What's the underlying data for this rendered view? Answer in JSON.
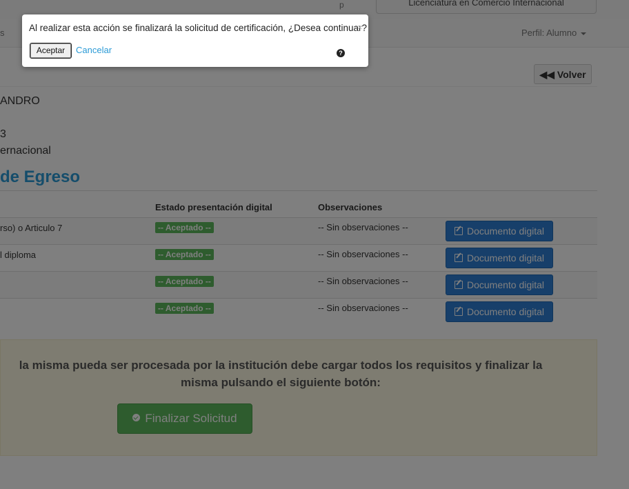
{
  "topbar": {
    "stub_text": "p",
    "career_select_value": "Licenciatura en Comercio Internacional"
  },
  "navbar": {
    "left_stub": "s",
    "perfil_label": "Perfil: Alumno"
  },
  "back_button_label": "Volver",
  "student_info": {
    "name_fragment": "ANDRO",
    "line2_fragment": "3",
    "line3_fragment": "ernacional"
  },
  "section_title": "de Egreso",
  "table": {
    "headers": {
      "estado": "Estado presentación digital",
      "observaciones": "Observaciones"
    },
    "rows": [
      {
        "requisito": "rso) o Articulo 7",
        "estado": "-- Aceptado --",
        "observaciones": "-- Sin observaciones --",
        "button": "Documento digital"
      },
      {
        "requisito": "l diploma",
        "estado": "-- Aceptado --",
        "observaciones": "-- Sin observaciones --",
        "button": "Documento digital"
      },
      {
        "requisito": "",
        "estado": "-- Aceptado --",
        "observaciones": "-- Sin observaciones --",
        "button": "Documento digital"
      },
      {
        "requisito": "",
        "estado": "-- Aceptado --",
        "observaciones": "-- Sin observaciones --",
        "button": "Documento digital"
      }
    ]
  },
  "notice": {
    "line1": "la misma pueda ser procesada por la institución debe cargar todos los requisitos y finalizar la",
    "line2": "misma pulsando el siguiente botón:",
    "button_label": "Finalizar Solicitud"
  },
  "dialog": {
    "message": "Al realizar esta acción se finalizará la solicitud de certificación, ¿Desea continuar?",
    "close_glyph": "×",
    "accept_label": "Aceptar",
    "cancel_label": "Cancelar",
    "help_glyph": "?"
  },
  "colors": {
    "accent_blue": "#2a9ad6",
    "success_green": "#5cb85c",
    "primary_blue": "#2f7fd4",
    "notice_bg": "#fcf8e3"
  }
}
